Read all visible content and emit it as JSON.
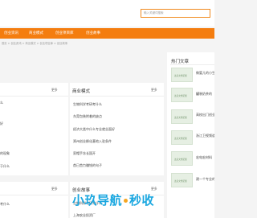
{
  "header": {
    "search_placeholder": "输入关键词搜索"
  },
  "nav": {
    "items": [
      "创业资讯",
      "商业模式",
      "创业项目库",
      "创业故事"
    ]
  },
  "breadcrumb": "首页 > 创业资讯 > 商业模式 > 创业项目库 > 创业故事",
  "panels": {
    "left_top": {
      "more": "更多",
      "items": [
        "么",
        "",
        "",
        "好",
        "的现象",
        "于什么"
      ]
    },
    "business_model": {
      "title": "商业模式",
      "more": "更多",
      "items": [
        "生物科学考研考什么",
        "东莞包装附着的缺点",
        "经济大类中什么专业就业面好",
        "郑州创业孵化基地入驻条件",
        "家帽手冻长国开",
        "首已首力赚钱的句子"
      ]
    },
    "left_bottom": {
      "more": "更多",
      "items": [
        "考什么",
        ""
      ]
    },
    "startup_story": {
      "title": "创业故事",
      "more": "更多",
      "items": [
        "生物科学考研考什么",
        "上海农业投资厂"
      ]
    }
  },
  "sidebar": {
    "title": "热门文章",
    "items": [
      {
        "thumb": "这是文章配图",
        "text": "做婴儿的小生"
      },
      {
        "thumb": "这是文章配图",
        "text": "罐装奶茶的"
      },
      {
        "thumb": "这是文章配图",
        "text": "高校出门创业"
      },
      {
        "thumb": "这是文章配图",
        "text": "浙江卫视频道"
      },
      {
        "thumb": "这是文章配图",
        "text": "宏电宏材料"
      },
      {
        "thumb": "这是文章配图",
        "text": "建一个专业的"
      }
    ]
  },
  "watermark": {
    "text_left": "小玖导航",
    "text_right": "秒收"
  }
}
